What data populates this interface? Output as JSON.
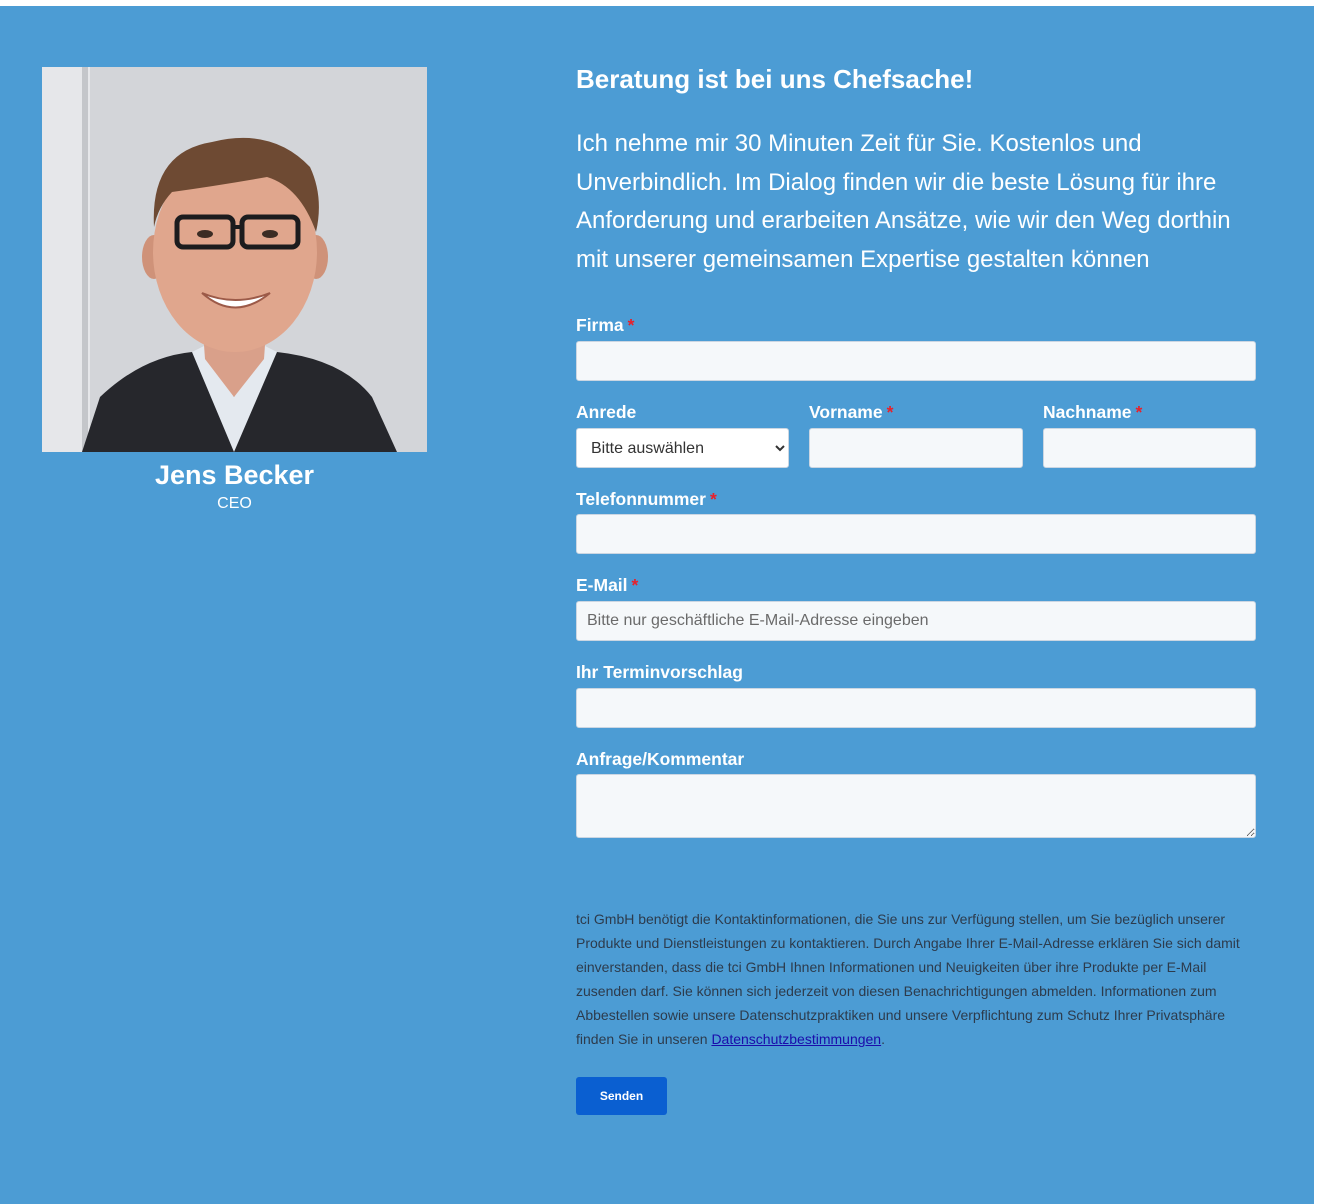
{
  "person": {
    "name": "Jens Becker",
    "role": "CEO"
  },
  "heading": "Beratung ist bei uns Chefsache!",
  "intro": {
    "strong": "Ich nehme mir 30 Minuten Zeit für Sie. Kostenlos und Unverbindlich.",
    "rest": " Im Dialog finden wir die beste Lösung für ihre Anforderung und erarbeiten Ansätze, wie wir den Weg dorthin mit unserer gemeinsamen Expertise gestalten können"
  },
  "form": {
    "required_mark": "*",
    "firma_label": "Firma",
    "anrede_label": "Anrede",
    "anrede_selected": "Bitte auswählen",
    "vorname_label": "Vorname",
    "nachname_label": "Nachname",
    "telefon_label": "Telefonnummer",
    "email_label": "E-Mail",
    "email_placeholder": "Bitte nur geschäftliche E-Mail-Adresse eingeben",
    "termin_label": "Ihr Terminvorschlag",
    "kommentar_label": "Anfrage/Kommentar",
    "submit_label": "Senden"
  },
  "legal": {
    "text": "tci GmbH benötigt die Kontaktinformationen, die Sie uns zur Verfügung stellen, um Sie bezüglich unserer Produkte und Dienstleistungen zu kontaktieren. Durch Angabe Ihrer E-Mail-Adresse erklären Sie sich damit einverstanden, dass die tci GmbH Ihnen Informationen und Neuigkeiten über ihre Produkte per E-Mail zusenden darf. Sie können sich jederzeit von diesen Benachrichtigungen abmelden. Informationen zum Abbestellen sowie unsere Datenschutzpraktiken und unsere Verpflichtung zum Schutz Ihrer Privatsphäre finden Sie in unseren ",
    "link": "Datenschutzbestimmungen",
    "end": "."
  },
  "colors": {
    "background": "#4c9cd4",
    "required": "#e8202a",
    "button": "#0a5fd1",
    "link": "#1a0dab"
  }
}
